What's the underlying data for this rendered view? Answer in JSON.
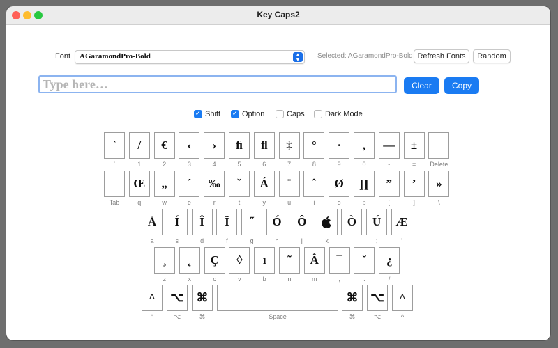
{
  "window": {
    "title": "Key Caps2"
  },
  "toolbar": {
    "font_label": "Font",
    "font_value": "AGaramondPro-Bold",
    "selected_text": "Selected: AGaramondPro-Bold",
    "refresh_label": "Refresh Fonts",
    "random_label": "Random"
  },
  "input": {
    "placeholder": "Type here…",
    "value": ""
  },
  "actions": {
    "clear_label": "Clear",
    "copy_label": "Copy"
  },
  "options": [
    {
      "label": "Shift",
      "checked": true
    },
    {
      "label": "Option",
      "checked": true
    },
    {
      "label": "Caps",
      "checked": false
    },
    {
      "label": "Dark Mode",
      "checked": false
    }
  ],
  "keyboard": {
    "rows": [
      [
        {
          "glyph": "`",
          "label": "`"
        },
        {
          "glyph": "/",
          "label": "1"
        },
        {
          "glyph": "€",
          "label": "2"
        },
        {
          "glyph": "‹",
          "label": "3"
        },
        {
          "glyph": "›",
          "label": "4"
        },
        {
          "glyph": "ﬁ",
          "label": "5"
        },
        {
          "glyph": "ﬂ",
          "label": "6"
        },
        {
          "glyph": "‡",
          "label": "7"
        },
        {
          "glyph": "°",
          "label": "8"
        },
        {
          "glyph": "·",
          "label": "9"
        },
        {
          "glyph": "‚",
          "label": "0"
        },
        {
          "glyph": "—",
          "label": "-"
        },
        {
          "glyph": "±",
          "label": "="
        },
        {
          "glyph": "",
          "label": "Delete"
        }
      ],
      [
        {
          "glyph": "",
          "label": "Tab"
        },
        {
          "glyph": "Œ",
          "label": "q"
        },
        {
          "glyph": "„",
          "label": "w"
        },
        {
          "glyph": "´",
          "label": "e"
        },
        {
          "glyph": "‰",
          "label": "r"
        },
        {
          "glyph": "ˇ",
          "label": "t"
        },
        {
          "glyph": "Á",
          "label": "y"
        },
        {
          "glyph": "¨",
          "label": "u"
        },
        {
          "glyph": "ˆ",
          "label": "i"
        },
        {
          "glyph": "Ø",
          "label": "o"
        },
        {
          "glyph": "∏",
          "label": "p"
        },
        {
          "glyph": "”",
          "label": "["
        },
        {
          "glyph": "’",
          "label": "]"
        },
        {
          "glyph": "»",
          "label": "\\"
        }
      ],
      [
        {
          "glyph": "Å",
          "label": "a"
        },
        {
          "glyph": "Í",
          "label": "s"
        },
        {
          "glyph": "Î",
          "label": "d"
        },
        {
          "glyph": "Ï",
          "label": "f"
        },
        {
          "glyph": "˝",
          "label": "g"
        },
        {
          "glyph": "Ó",
          "label": "h"
        },
        {
          "glyph": "Ô",
          "label": "j"
        },
        {
          "glyph": "",
          "label": "k"
        },
        {
          "glyph": "Ò",
          "label": "l"
        },
        {
          "glyph": "Ú",
          "label": ";"
        },
        {
          "glyph": "Æ",
          "label": "'"
        }
      ],
      [
        {
          "glyph": "¸",
          "label": "z"
        },
        {
          "glyph": "˛",
          "label": "x"
        },
        {
          "glyph": "Ç",
          "label": "c"
        },
        {
          "glyph": "◊",
          "label": "v"
        },
        {
          "glyph": "ı",
          "label": "b"
        },
        {
          "glyph": "˜",
          "label": "n"
        },
        {
          "glyph": "Â",
          "label": "m"
        },
        {
          "glyph": "¯",
          "label": ","
        },
        {
          "glyph": "˘",
          "label": "."
        },
        {
          "glyph": "¿",
          "label": "/"
        }
      ],
      [
        {
          "glyph": "^",
          "label": "^"
        },
        {
          "glyph": "⌥",
          "label": "⌥"
        },
        {
          "glyph": "⌘",
          "label": "⌘"
        },
        {
          "glyph": "",
          "label": "Space"
        },
        {
          "glyph": "⌘",
          "label": "⌘"
        },
        {
          "glyph": "⌥",
          "label": "⌥"
        },
        {
          "glyph": "^",
          "label": "^"
        }
      ]
    ]
  }
}
